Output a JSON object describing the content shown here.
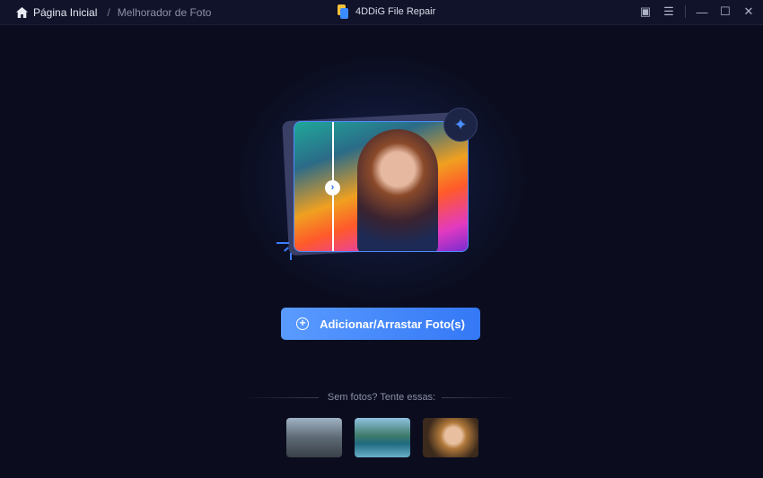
{
  "titlebar": {
    "home_label": "Página Inicial",
    "separator": "/",
    "current_page": "Melhorador de Foto",
    "app_title": "4DDiG File Repair"
  },
  "main": {
    "add_button_label": "Adicionar/Arrastar Foto(s)",
    "samples_hint": "Sem fotos? Tente essas:",
    "samples": [
      "city-sample",
      "lake-sample",
      "portrait-sample"
    ]
  },
  "colors": {
    "accent": "#3478f6",
    "background": "#0b0d1f"
  }
}
